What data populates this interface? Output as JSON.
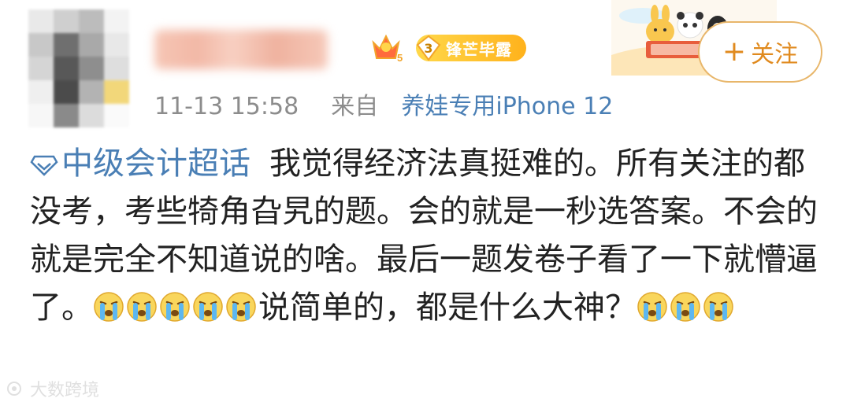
{
  "header": {
    "timestamp": "11-13 15:58",
    "source_prefix": "来自",
    "source_device": "养娃专用iPhone 12",
    "vip_level": "5",
    "badge_level": "3",
    "badge_text": "锋芒毕露",
    "follow_label": "关注",
    "follow_plus": "+"
  },
  "post": {
    "topic": "中级会计超话",
    "text_main": "我觉得经济法真挺难的。所有关注的都没考，考些犄角旮旯的题。会的就是一秒选答案。不会的就是完全不知道说的啥。最后一题发卷子看了一下就懵逼了。",
    "text_mid": "说简单的，都是什么大神？",
    "emoji_name": "crying-emoji"
  },
  "watermark": {
    "text": "大数跨境"
  },
  "colors": {
    "link": "#4a7fb5",
    "meta": "#8c8c8c",
    "follow": "#e08a1e"
  }
}
